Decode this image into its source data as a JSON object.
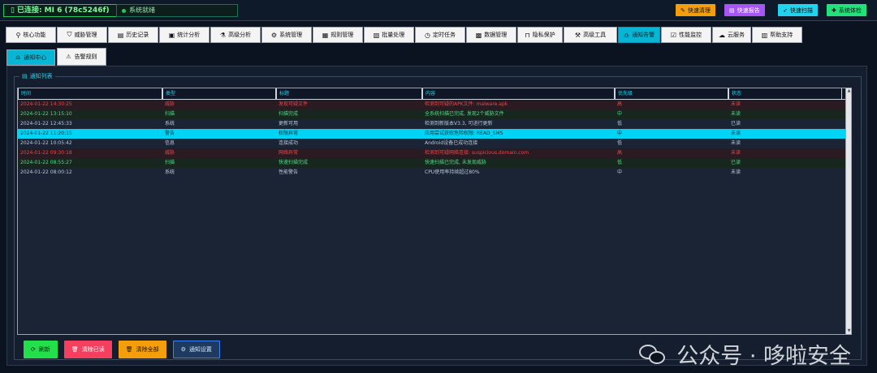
{
  "topbar": {
    "connection": "已连接: MI 6 (78c5246f)",
    "status": "系统就绪",
    "quick_buttons": [
      {
        "label": "快速清理",
        "color": "#f59e0b",
        "icon": "broom-icon"
      },
      {
        "label": "快速报告",
        "color": "#a855f7",
        "icon": "report-icon"
      },
      {
        "label": "快速扫描",
        "color": "#22d3ee",
        "icon": "rocket-icon"
      },
      {
        "label": "系统体检",
        "color": "#22e07a",
        "icon": "health-icon"
      }
    ]
  },
  "tabs": [
    {
      "label": "核心功能",
      "icon": "search-icon"
    },
    {
      "label": "威胁管理",
      "icon": "shield-icon"
    },
    {
      "label": "历史记录",
      "icon": "history-icon"
    },
    {
      "label": "统计分析",
      "icon": "stats-icon"
    },
    {
      "label": "高级分析",
      "icon": "flask-icon"
    },
    {
      "label": "系统管理",
      "icon": "gear-icon"
    },
    {
      "label": "规则管理",
      "icon": "rules-icon"
    },
    {
      "label": "批量处理",
      "icon": "batch-icon"
    },
    {
      "label": "定时任务",
      "icon": "clock-icon"
    },
    {
      "label": "数据管理",
      "icon": "database-icon"
    },
    {
      "label": "隐私保护",
      "icon": "lock-icon"
    },
    {
      "label": "高级工具",
      "icon": "tools-icon"
    },
    {
      "label": "通知告警",
      "icon": "bell-icon"
    },
    {
      "label": "性能监控",
      "icon": "monitor-icon"
    },
    {
      "label": "云服务",
      "icon": "cloud-icon"
    },
    {
      "label": "帮助支持",
      "icon": "help-icon"
    }
  ],
  "subtabs": [
    {
      "label": "通知中心",
      "icon": "bell-icon"
    },
    {
      "label": "告警规则",
      "icon": "warning-icon"
    }
  ],
  "group_title": "通知列表",
  "table": {
    "headers": [
      "时间",
      "类型",
      "标题",
      "内容",
      "优先级",
      "状态"
    ],
    "rows": [
      {
        "kind": "threat",
        "cells": [
          "2024-01-22 14:30:25",
          "威胁",
          "发现可疑文件",
          "检测到可疑的APK文件: malware.apk",
          "高",
          "未读"
        ]
      },
      {
        "kind": "scan",
        "cells": [
          "2024-01-22 13:15:10",
          "扫描",
          "扫描完成",
          "全系统扫描已完成, 发现2个威胁文件",
          "中",
          "未读"
        ]
      },
      {
        "kind": "normal",
        "cells": [
          "2024-01-22 12:45:33",
          "系统",
          "更新可用",
          "检测到新版本V3.3, 可进行更新",
          "低",
          "已读"
        ]
      },
      {
        "kind": "selected",
        "cells": [
          "2024-01-22 11:20:15",
          "警告",
          "权限异常",
          "应用尝试获取危险权限: READ_SMS",
          "中",
          "未读"
        ]
      },
      {
        "kind": "normal",
        "cells": [
          "2024-01-22 10:05:42",
          "信息",
          "连接成功",
          "Android设备已成功连接",
          "低",
          "未读"
        ]
      },
      {
        "kind": "threat",
        "cells": [
          "2024-01-22 09:30:18",
          "威胁",
          "网络异常",
          "检测到可疑网络连接: suspicious.domain.com",
          "高",
          "未读"
        ]
      },
      {
        "kind": "scan",
        "cells": [
          "2024-01-22 08:55:27",
          "扫描",
          "快速扫描完成",
          "快速扫描已完成, 未发现威胁",
          "低",
          "已读"
        ]
      },
      {
        "kind": "normal",
        "cells": [
          "2024-01-22 08:00:12",
          "系统",
          "性能警告",
          "CPU使用率持续超过80%",
          "中",
          "未读"
        ]
      }
    ]
  },
  "actions": [
    {
      "label": "刷新",
      "color": "#22e04a",
      "icon": "refresh-icon"
    },
    {
      "label": "清除已读",
      "color": "#f43f5e",
      "icon": "trash-icon"
    },
    {
      "label": "清除全部",
      "color": "#f59e0b",
      "icon": "trash-icon"
    },
    {
      "label": "通知设置",
      "color": "#1e3a5f",
      "icon": "gear-icon"
    }
  ],
  "watermark": "公众号 · 哆啦安全"
}
